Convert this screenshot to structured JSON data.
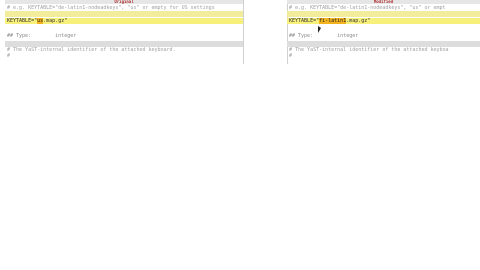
{
  "left_pane": {
    "header": "Original",
    "lines": [
      {
        "text": "# e.g. KEYTABLE=\"de-latin1-nodeadkeys\", \"us\" or empty for US settings"
      },
      {
        "text": ""
      },
      {
        "prefix": "KEYTABLE=\"",
        "mark": "us",
        "suffix": ".map.gz\""
      },
      {
        "text": "## Type:        integer"
      },
      {
        "text": ""
      },
      {
        "text": "# The YaST-internal identifier of the attached keyboard."
      },
      {
        "text": "#"
      }
    ]
  },
  "right_pane": {
    "header": "Modified",
    "lines": [
      {
        "text": "# e.g. KEYTABLE=\"de-latin1-nodeadkeys\", \"us\" or empt"
      },
      {
        "text": ""
      },
      {
        "prefix": "KEYTABLE=\"",
        "mark": "fi-latin1",
        "suffix": ".map.gz\""
      },
      {
        "text": "## Type:        integer"
      },
      {
        "text": ""
      },
      {
        "text": "# The YaST-internal identifier of the attached keyboa"
      },
      {
        "text": "#"
      }
    ]
  }
}
